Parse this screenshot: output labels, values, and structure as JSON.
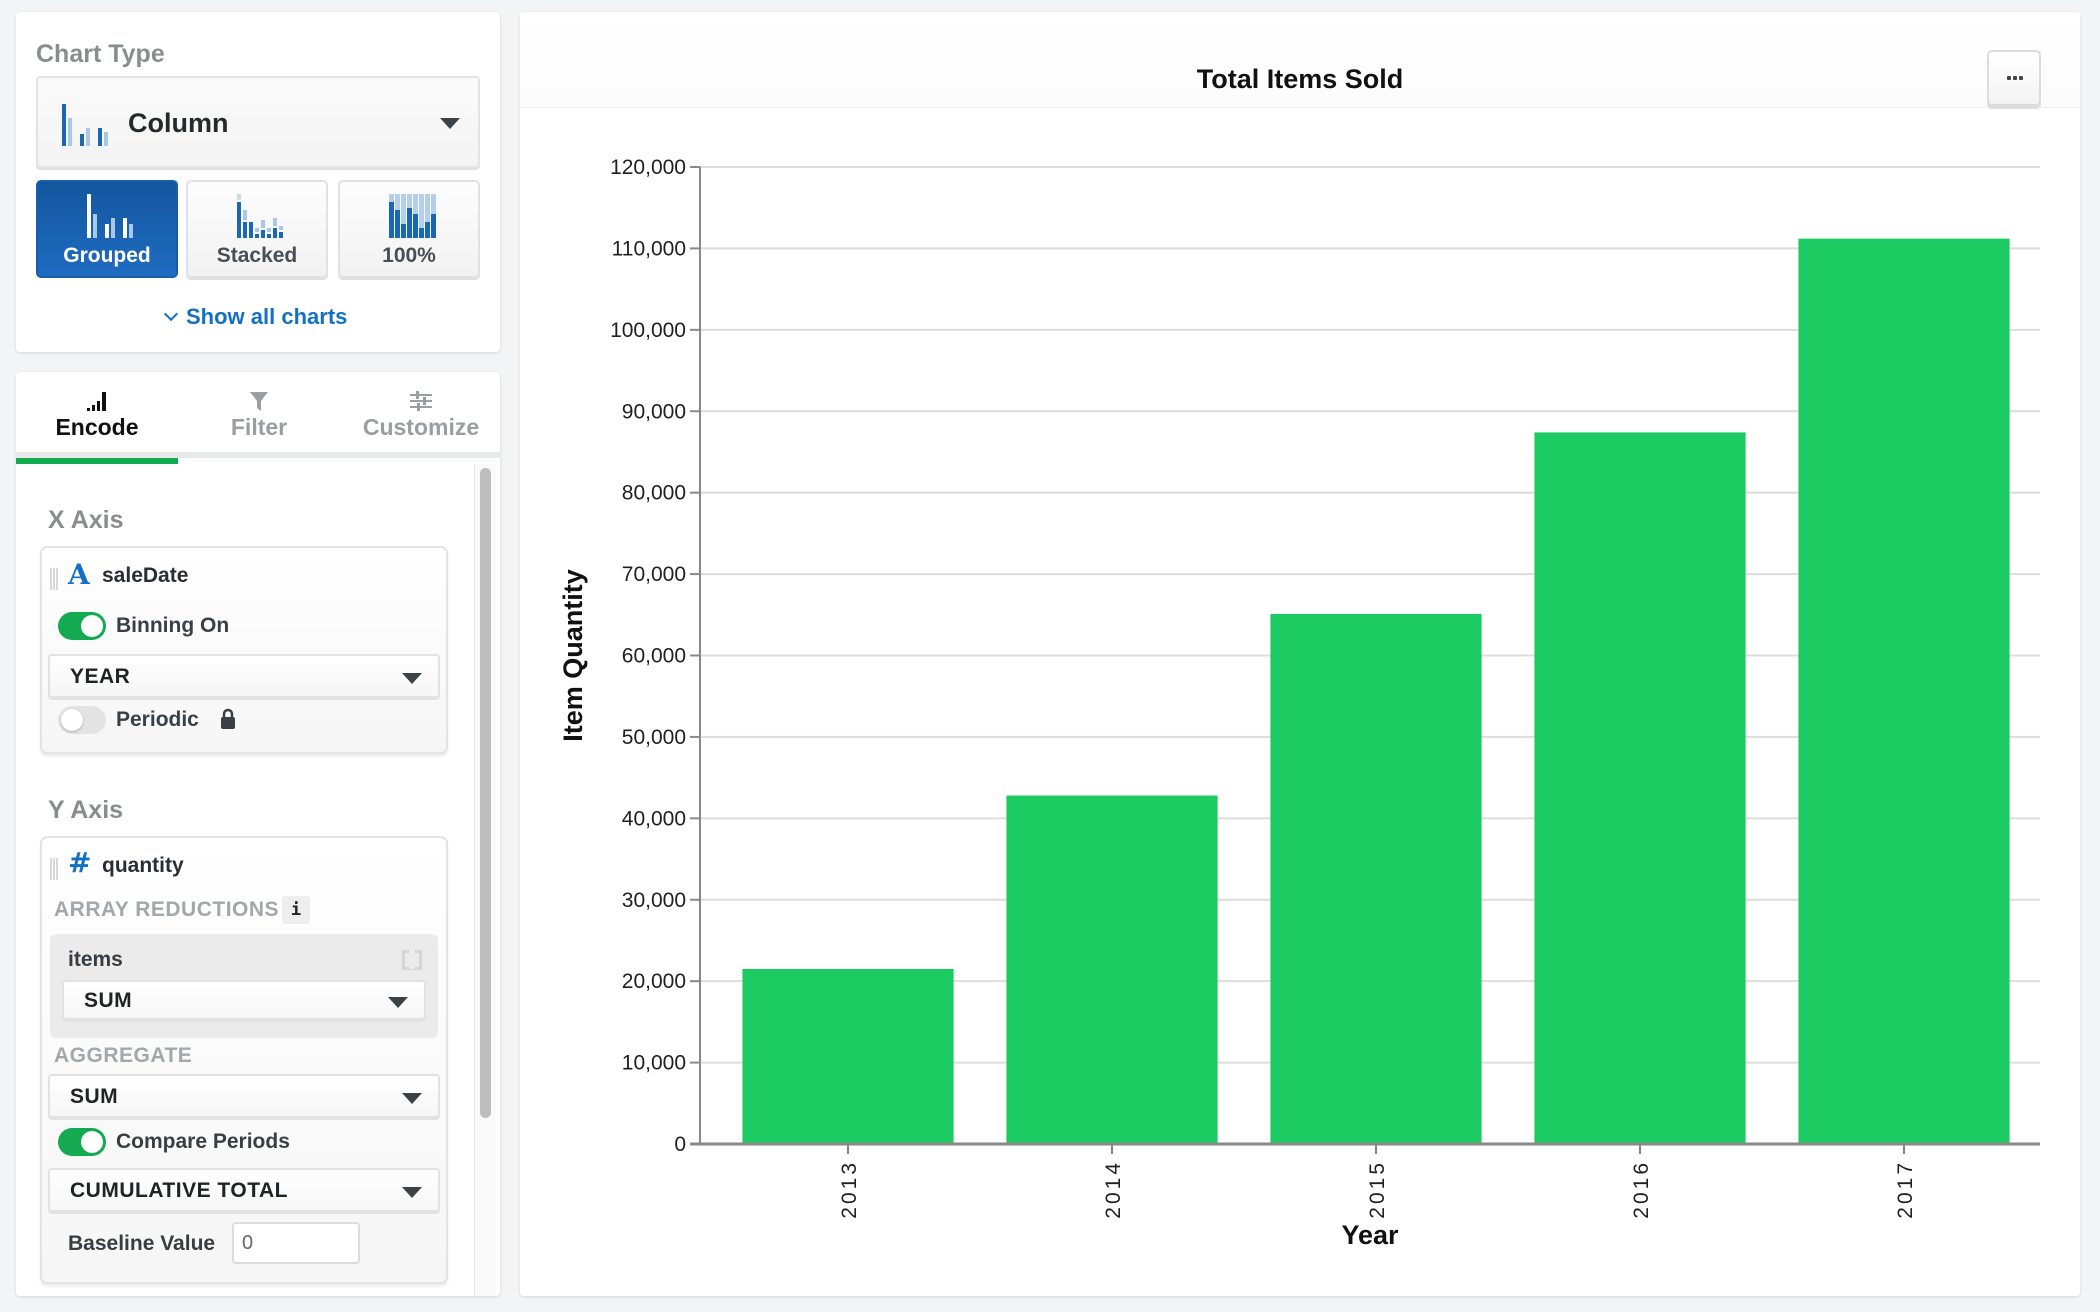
{
  "chart_type_panel": {
    "title": "Chart Type",
    "selected_type": "Column",
    "selected_type_icon": "column-chart-icon",
    "variants": [
      {
        "label": "Grouped",
        "icon": "grouped-column-icon",
        "active": true
      },
      {
        "label": "Stacked",
        "icon": "stacked-column-icon",
        "active": false
      },
      {
        "label": "100%",
        "icon": "percent-column-icon",
        "active": false
      }
    ],
    "show_all_label": "Show all charts"
  },
  "encode_panel": {
    "tabs": [
      {
        "label": "Encode",
        "icon": "encode-bars-icon",
        "active": true
      },
      {
        "label": "Filter",
        "icon": "filter-funnel-icon",
        "active": false
      },
      {
        "label": "Customize",
        "icon": "sliders-icon",
        "active": false
      }
    ],
    "x_axis": {
      "section_title": "X Axis",
      "field_name": "saleDate",
      "field_type_icon": "string-type-icon",
      "field_type_glyph": "A",
      "binning_label": "Binning On",
      "binning_on": true,
      "bin_value": "YEAR",
      "periodic_label": "Periodic",
      "periodic_on": false,
      "periodic_locked": true
    },
    "y_axis": {
      "section_title": "Y Axis",
      "field_name": "quantity",
      "field_type_icon": "number-type-icon",
      "field_type_glyph": "#",
      "array_reductions_label": "ARRAY REDUCTIONS",
      "info_glyph": "i",
      "reduction_field": "items",
      "reduction_value": "SUM",
      "aggregate_label": "AGGREGATE",
      "aggregate_value": "SUM",
      "compare_label": "Compare Periods",
      "compare_on": true,
      "compare_value": "CUMULATIVE TOTAL",
      "baseline_label": "Baseline Value",
      "baseline_value": "0"
    }
  },
  "chart_panel": {
    "more_button_icon": "ellipsis-icon",
    "bar_color": "#1ccb61"
  },
  "chart_data": {
    "type": "bar",
    "title": "Total Items Sold",
    "xlabel": "Year",
    "ylabel": "Item Quantity",
    "categories": [
      "2013",
      "2014",
      "2015",
      "2016",
      "2017"
    ],
    "values": [
      21500,
      42800,
      65100,
      87400,
      111200
    ],
    "ylim": [
      0,
      120000
    ],
    "yticks": [
      0,
      10000,
      20000,
      30000,
      40000,
      50000,
      60000,
      70000,
      80000,
      90000,
      100000,
      110000,
      120000
    ],
    "ytick_labels": [
      "0",
      "10,000",
      "20,000",
      "30,000",
      "40,000",
      "50,000",
      "60,000",
      "70,000",
      "80,000",
      "90,000",
      "100,000",
      "110,000",
      "120,000"
    ],
    "grid": true,
    "legend": "none"
  }
}
